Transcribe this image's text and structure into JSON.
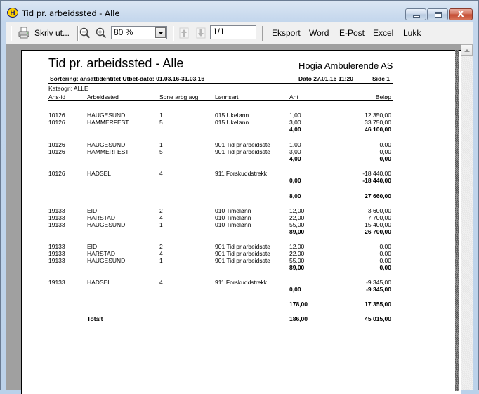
{
  "window": {
    "title": "Tid pr. arbeidssted - Alle",
    "app_icon": "hogia-h-icon",
    "controls": {
      "minimize": "minimize",
      "maximize": "maximize",
      "close": "X"
    }
  },
  "toolbar": {
    "print_label": "Skriv ut...",
    "print_icon": "printer-icon",
    "zoom_out_icon": "zoom-out-icon",
    "zoom_in_icon": "zoom-in-icon",
    "zoom_value": "80 %",
    "prev_page_icon": "arrow-up-icon",
    "next_page_icon": "arrow-down-icon",
    "page_value": "1/1",
    "export_label": "Eksport",
    "word_label": "Word",
    "email_label": "E-Post",
    "excel_label": "Excel",
    "close_label": "Lukk"
  },
  "report": {
    "title": "Tid pr. arbeidssted - Alle",
    "company": "Hogia Ambulerende AS",
    "sorting": "Sortering: ansattidentitet  Utbet-dato: 01.03.16-31.03.16",
    "date": "Dato  27.01.16 11:20",
    "page": "Side 1",
    "category": "Kateogri: ALLE",
    "columns": [
      "Ans-id",
      "Arbeidssted",
      "Sone arbg.avg.",
      "Lønnsart",
      "Ant",
      "Beløp"
    ],
    "rows": [
      {
        "id": "10126",
        "place": "HAUGESUND",
        "sone": "1",
        "lonn": "015 Ukelønn",
        "ant": "1,00",
        "belop": "12 350,00"
      },
      {
        "id": "10126",
        "place": "HAMMERFEST",
        "sone": "5",
        "lonn": "015 Ukelønn",
        "ant": "3,00",
        "belop": "33 750,00"
      },
      {
        "id": "",
        "place": "",
        "sone": "",
        "lonn": "",
        "ant": "4,00",
        "belop": "46 100,00",
        "subtotal": true
      },
      {
        "id": "10126",
        "place": "HAUGESUND",
        "sone": "1",
        "lonn": "901 Tid pr.arbeidsste",
        "ant": "1,00",
        "belop": "0,00"
      },
      {
        "id": "10126",
        "place": "HAMMERFEST",
        "sone": "5",
        "lonn": "901 Tid pr.arbeidsste",
        "ant": "3,00",
        "belop": "0,00"
      },
      {
        "id": "",
        "place": "",
        "sone": "",
        "lonn": "",
        "ant": "4,00",
        "belop": "0,00",
        "subtotal": true
      },
      {
        "id": "10126",
        "place": "HADSEL",
        "sone": "4",
        "lonn": "911 Forskuddstrekk",
        "ant": "",
        "belop": "-18 440,00"
      },
      {
        "id": "",
        "place": "",
        "sone": "",
        "lonn": "",
        "ant": "0,00",
        "belop": "-18 440,00",
        "subtotal": true
      },
      {
        "id": "",
        "place": "",
        "sone": "",
        "lonn": "",
        "ant": "8,00",
        "belop": "27 660,00",
        "subtotal": true
      },
      {
        "id": "19133",
        "place": "EID",
        "sone": "2",
        "lonn": "010 Timelønn",
        "ant": "12,00",
        "belop": "3 600,00"
      },
      {
        "id": "19133",
        "place": "HARSTAD",
        "sone": "4",
        "lonn": "010 Timelønn",
        "ant": "22,00",
        "belop": "7 700,00"
      },
      {
        "id": "19133",
        "place": "HAUGESUND",
        "sone": "1",
        "lonn": "010 Timelønn",
        "ant": "55,00",
        "belop": "15 400,00"
      },
      {
        "id": "",
        "place": "",
        "sone": "",
        "lonn": "",
        "ant": "89,00",
        "belop": "26 700,00",
        "subtotal": true
      },
      {
        "id": "19133",
        "place": "EID",
        "sone": "2",
        "lonn": "901 Tid pr.arbeidsste",
        "ant": "12,00",
        "belop": "0,00"
      },
      {
        "id": "19133",
        "place": "HARSTAD",
        "sone": "4",
        "lonn": "901 Tid pr.arbeidsste",
        "ant": "22,00",
        "belop": "0,00"
      },
      {
        "id": "19133",
        "place": "HAUGESUND",
        "sone": "1",
        "lonn": "901 Tid pr.arbeidsste",
        "ant": "55,00",
        "belop": "0,00"
      },
      {
        "id": "",
        "place": "",
        "sone": "",
        "lonn": "",
        "ant": "89,00",
        "belop": "0,00",
        "subtotal": true
      },
      {
        "id": "19133",
        "place": "HADSEL",
        "sone": "4",
        "lonn": "911 Forskuddstrekk",
        "ant": "",
        "belop": "-9 345,00"
      },
      {
        "id": "",
        "place": "",
        "sone": "",
        "lonn": "",
        "ant": "0,00",
        "belop": "-9 345,00",
        "subtotal": true
      },
      {
        "id": "",
        "place": "",
        "sone": "",
        "lonn": "",
        "ant": "178,00",
        "belop": "17 355,00",
        "subtotal": true
      },
      {
        "id": "",
        "place": "Totalt",
        "sone": "",
        "lonn": "",
        "ant": "186,00",
        "belop": "45 015,00",
        "subtotal": true
      }
    ]
  }
}
